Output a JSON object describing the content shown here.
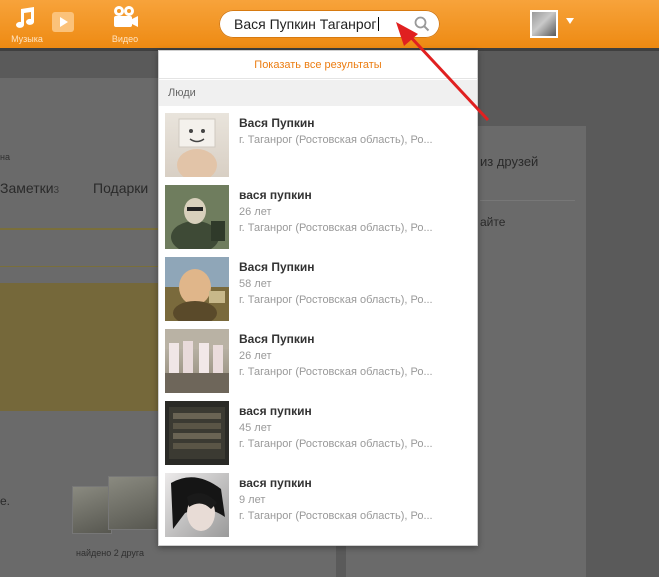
{
  "topbar": {
    "music_label": "Музыка",
    "video_label": "Видео",
    "search_value": "Вася Пупкин Таганрог",
    "accent_color": "#ee8a12"
  },
  "background_page": {
    "fragment_na": "на",
    "tab_notes": "Заметки",
    "tab_notes_count": "3",
    "tab_gifts": "Подарки",
    "right_friends": "из друзей",
    "right_aite": "айте",
    "left_e": "е.",
    "found_friends": "найдено 2 друга"
  },
  "dropdown": {
    "show_all": "Показать все результаты",
    "section_people": "Люди",
    "results": [
      {
        "name": "Вася Пупкин",
        "age": "",
        "location": "г. Таганрог (Ростовская область), Ро..."
      },
      {
        "name": "вася пупкин",
        "age": "26 лет",
        "location": "г. Таганрог (Ростовская область), Ро..."
      },
      {
        "name": "Вася Пупкин",
        "age": "58 лет",
        "location": "г. Таганрог (Ростовская область), Ро..."
      },
      {
        "name": "Вася Пупкин",
        "age": "26 лет",
        "location": "г. Таганрог (Ростовская область), Ро..."
      },
      {
        "name": "вася пупкин",
        "age": "45 лет",
        "location": "г. Таганрог (Ростовская область), Ро..."
      },
      {
        "name": "вася пупкин",
        "age": "9 лет",
        "location": "г. Таганрог (Ростовская область), Ро..."
      }
    ]
  },
  "annotation": {
    "arrow_color": "#e02020"
  }
}
